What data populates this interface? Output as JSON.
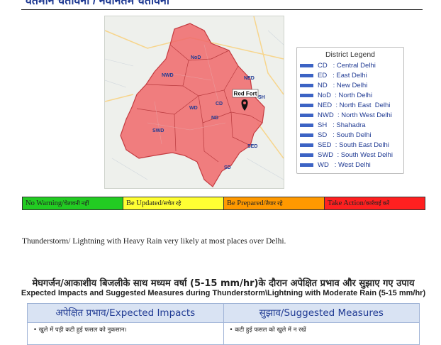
{
  "page": {
    "top_heading": "वर्तमान चेतावनी / नवीनतम चेतावनी",
    "forecast_text": "Thunderstorm/ Lightning with Heavy Rain very likely at most places over Delhi.",
    "hindi_title": "मेघगर्जन/आकाशीय बिजलीके साथ मध्यम वर्षा (5-15 mm/hr)के दौरान अपेक्षित प्रभाव और सुझाए गए उपाय",
    "english_title": "Expected Impacts and Suggested Measures during Thunderstorm\\Lightning  with Moderate Rain (5-15 mm/hr)"
  },
  "map": {
    "fill_color": "#f0686b",
    "marker_label": "Red Fort",
    "district_labels": [
      "NoD",
      "NED",
      "NWD",
      "WD",
      "CD",
      "ND",
      "SWD",
      "SD",
      "SED",
      "SH"
    ]
  },
  "legend": {
    "title": "District Legend",
    "swatch_color": "#3c63c4",
    "items": [
      "CD   : Central Delhi",
      "ED   : East Delhi",
      "ND   : New Delhi",
      "NoD  : North Delhi",
      "NED  : North East  Delhi",
      "NWD  : North West Delhi",
      "SH   : Shahadra",
      "SD   : South Delhi",
      "SED  : South East Delhi",
      "SWD  : South West Delhi",
      "WD   : West Delhi"
    ]
  },
  "warnings": [
    {
      "label": "No Warning/",
      "hindi": "चेतावनी नहीं",
      "color": "#22cc22"
    },
    {
      "label": "Be Updated/",
      "hindi": "सचेत रहे",
      "color": "#ffff33"
    },
    {
      "label": "Be Prepared/",
      "hindi": "तैयार रहे",
      "color": "#ff9900"
    },
    {
      "label": "Take Action/",
      "hindi": "कार्रवाई करें",
      "color": "#ff2020"
    }
  ],
  "impacts_table": {
    "header_impacts": "अपेक्षित प्रभाव/Expected Impacts",
    "header_measures": "सुझाव/Suggested Measures",
    "row_impact": "•  खुले में पड़ी कटी हुई फसल को नुकसान।",
    "row_measure": "•  कटी हुई फसल को खुले में न रखें"
  }
}
